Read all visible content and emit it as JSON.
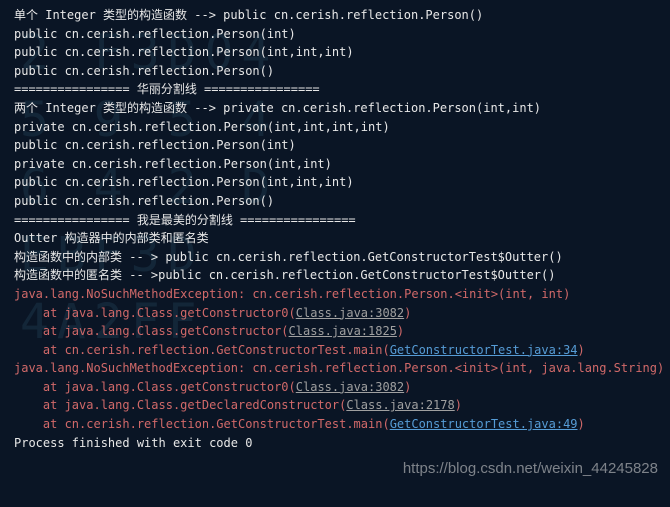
{
  "bg": "2 F3D04\n5 9 5 4\n6 4 2 D\nEBF3D\n4A2FF",
  "lines": [
    {
      "cls": "white",
      "txt": "单个 Integer 类型的构造函数 --> public cn.cerish.reflection.Person()"
    },
    {
      "cls": "white",
      "txt": "public cn.cerish.reflection.Person(int)"
    },
    {
      "cls": "white",
      "txt": "public cn.cerish.reflection.Person(int,int,int)"
    },
    {
      "cls": "white",
      "txt": "public cn.cerish.reflection.Person()"
    },
    {
      "cls": "white",
      "txt": "================ 华丽分割线 ================"
    },
    {
      "cls": "white",
      "txt": "两个 Integer 类型的构造函数 --> private cn.cerish.reflection.Person(int,int)"
    },
    {
      "cls": "white",
      "txt": "private cn.cerish.reflection.Person(int,int,int,int)"
    },
    {
      "cls": "white",
      "txt": "public cn.cerish.reflection.Person(int)"
    },
    {
      "cls": "white",
      "txt": "private cn.cerish.reflection.Person(int,int)"
    },
    {
      "cls": "white",
      "txt": "public cn.cerish.reflection.Person(int,int,int)"
    },
    {
      "cls": "white",
      "txt": "public cn.cerish.reflection.Person()"
    },
    {
      "cls": "white",
      "txt": "================ 我是最美的分割线 ================"
    },
    {
      "cls": "white",
      "txt": "Outter 构造器中的内部类和匿名类"
    },
    {
      "cls": "white",
      "txt": "构造函数中的内部类 -- > public cn.cerish.reflection.GetConstructorTest$Outter()"
    },
    {
      "cls": "white",
      "txt": "构造函数中的匿名类 -- >public cn.cerish.reflection.GetConstructorTest$Outter()"
    },
    {
      "cls": "red",
      "txt": "java.lang.NoSuchMethodException: cn.cerish.reflection.Person.<init>(int, int)"
    },
    {
      "cls": "red",
      "parts": [
        {
          "t": "    at java.lang.Class.getConstructor0("
        },
        {
          "t": "Class.java:3082",
          "cls": "gray-u"
        },
        {
          "t": ")"
        }
      ]
    },
    {
      "cls": "red",
      "parts": [
        {
          "t": "    at java.lang.Class.getConstructor("
        },
        {
          "t": "Class.java:1825",
          "cls": "gray-u"
        },
        {
          "t": ")"
        }
      ]
    },
    {
      "cls": "red",
      "parts": [
        {
          "t": "    at cn.cerish.reflection.GetConstructorTest.main("
        },
        {
          "t": "GetConstructorTest.java:34",
          "cls": "blue-u"
        },
        {
          "t": ")"
        }
      ]
    },
    {
      "cls": "red",
      "txt": "java.lang.NoSuchMethodException: cn.cerish.reflection.Person.<init>(int, java.lang.String)"
    },
    {
      "cls": "red",
      "parts": [
        {
          "t": "    at java.lang.Class.getConstructor0("
        },
        {
          "t": "Class.java:3082",
          "cls": "gray-u"
        },
        {
          "t": ")"
        }
      ]
    },
    {
      "cls": "red",
      "parts": [
        {
          "t": "    at java.lang.Class.getDeclaredConstructor("
        },
        {
          "t": "Class.java:2178",
          "cls": "gray-u"
        },
        {
          "t": ")"
        }
      ]
    },
    {
      "cls": "red",
      "parts": [
        {
          "t": "    at cn.cerish.reflection.GetConstructorTest.main("
        },
        {
          "t": "GetConstructorTest.java:49",
          "cls": "blue-u"
        },
        {
          "t": ")"
        }
      ]
    },
    {
      "cls": "white",
      "txt": ""
    },
    {
      "cls": "white",
      "txt": "Process finished with exit code 0"
    }
  ],
  "watermark": "https://blog.csdn.net/weixin_44245828"
}
